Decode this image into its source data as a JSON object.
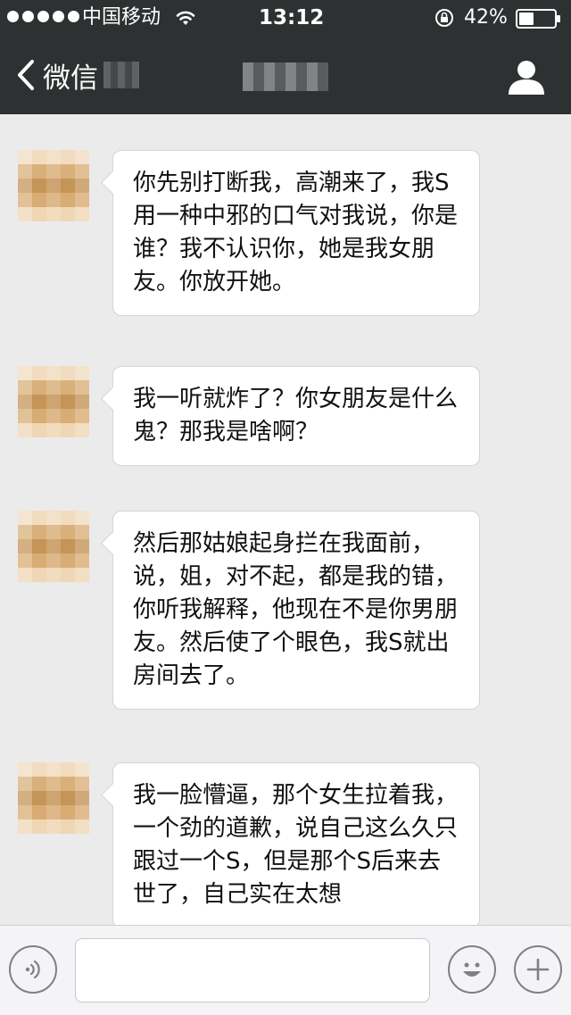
{
  "status_bar": {
    "carrier": "中国移动",
    "time": "13:12",
    "battery_percent": "42%",
    "battery_level": 0.42,
    "signal_bars": 5,
    "icons": [
      "signal-dots-icon",
      "wifi-icon",
      "rotation-lock-icon",
      "battery-icon"
    ]
  },
  "nav": {
    "back_label": "微信",
    "back_icon": "chevron-left-icon",
    "profile_icon": "person-icon"
  },
  "messages": [
    {
      "sender": "contact",
      "text": "你先别打断我，高潮来了，我S用一种中邪的口气对我说，你是谁？我不认识你，她是我女朋友。你放开她。"
    },
    {
      "sender": "contact",
      "text": "我一听就炸了？你女朋友是什么鬼？那我是啥啊？"
    },
    {
      "sender": "contact",
      "text": "然后那姑娘起身拦在我面前，说，姐，对不起，都是我的错，你听我解释，他现在不是你男朋友。然后使了个眼色，我S就出房间去了。"
    },
    {
      "sender": "contact",
      "text": "我一脸懵逼，那个女生拉着我，一个劲的道歉，说自己这么久只跟过一个S，但是那个S后来去世了，自己实在太想"
    }
  ],
  "toolbar": {
    "input_value": "",
    "voice_icon": "voice-icon",
    "emoji_icon": "smiley-icon",
    "more_icon": "plus-icon"
  },
  "colors": {
    "header_bg": "#2e3132",
    "chat_bg": "#ebebeb",
    "bubble_bg": "#ffffff",
    "toolbar_bg": "#f4f4f6"
  }
}
